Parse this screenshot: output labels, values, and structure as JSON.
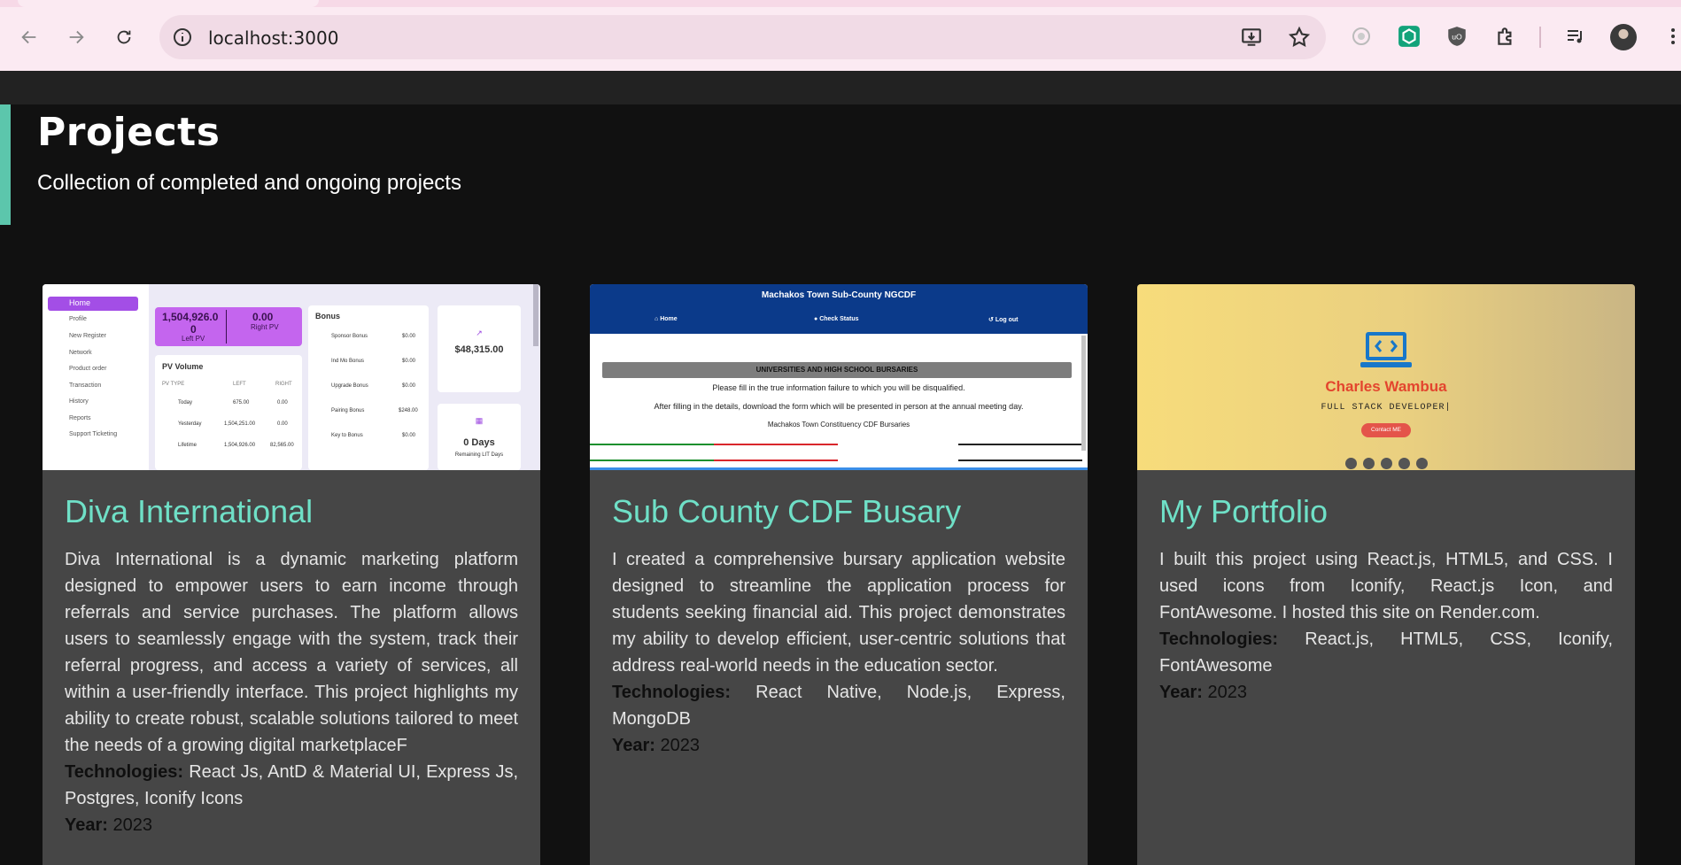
{
  "browser": {
    "url": "localhost:3000"
  },
  "page": {
    "title": "Projects",
    "subtitle": "Collection of completed and ongoing projects"
  },
  "projects": [
    {
      "title": "Diva International",
      "description": "Diva International is a dynamic marketing platform designed to empower users to earn income through referrals and service purchases. The platform allows users to seamlessly engage with the system, track their referral progress, and access a variety of services, all within a user-friendly interface. This project highlights my ability to create robust, scalable solutions tailored to meet the needs of a growing digital marketplaceF",
      "tech_label": "Technologies:",
      "tech": "React Js, AntD & Material UI, Express Js, Postgres, Iconify Icons",
      "year_label": "Year:",
      "year": "2023",
      "thumb": {
        "menu": [
          "Home",
          "Profile",
          "New Register",
          "Network",
          "Product order",
          "Transaction",
          "History",
          "Reports",
          "Support Ticketing"
        ],
        "stats": [
          "1,504,926.0",
          "0",
          "0.00"
        ],
        "stat_labels": [
          "Left PV",
          "Right PV"
        ],
        "bonus_title": "Bonus",
        "bonus_rows": [
          "Sponsor Bonus",
          "Ind Mo Bonus",
          "Upgrade Bonus",
          "Pairing Bonus",
          "Key to Bonus"
        ],
        "bonus_values": [
          "$0.00",
          "$0.00",
          "$0.00",
          "$248.00",
          "$0.00"
        ],
        "pv_title": "PV Volume",
        "pv_headers": [
          "PV TYPE",
          "LEFT",
          "RIGHT"
        ],
        "pv_rows": [
          [
            "Today",
            "675.00",
            "0.00"
          ],
          [
            "Yesterday",
            "1,504,251.00",
            "0.00"
          ],
          [
            "Lifetime",
            "1,504,926.00",
            "82,565.00"
          ]
        ],
        "withdrawable": "$48,315.00",
        "days": "0 Days",
        "days_label": "Remaining LIT Days"
      }
    },
    {
      "title": "Sub County CDF Busary",
      "description": "I created a comprehensive bursary application website designed to streamline the application process for students seeking financial aid. This project demonstrates my ability to develop efficient, user-centric solutions that address real-world needs in the education sector.",
      "tech_label": "Technologies:",
      "tech": "React Native, Node.js, Express, MongoDB",
      "year_label": "Year:",
      "year": "2023",
      "thumb": {
        "header": "Machakos Town Sub-County NGCDF",
        "nav": [
          "Home",
          "Check Status",
          "Log out"
        ],
        "band": "UNIVERSITIES AND HIGH SCHOOL BURSARIES",
        "lines": [
          "Please fill in the true information failure to which you will be disqualified.",
          "After filling in the details, download the form which will be presented in person at the annual meeting day.",
          "Machakos Town Constituency CDF Bursaries"
        ]
      }
    },
    {
      "title": "My Portfolio",
      "description": "I built this project using React.js, HTML5, and CSS. I used icons from Iconify, React.js Icon, and FontAwesome. I hosted this site on Render.com.",
      "tech_label": "Technologies:",
      "tech": "React.js, HTML5, CSS, Iconify, FontAwesome",
      "year_label": "Year:",
      "year": "2023",
      "thumb": {
        "name": "Charles Wambua",
        "role": "FULL STACK DEVELOPER|",
        "button": "Contact ME"
      }
    }
  ],
  "colors": {
    "accent": "#6fe0c7",
    "card_bg": "#464646",
    "page_bg": "#111111"
  }
}
